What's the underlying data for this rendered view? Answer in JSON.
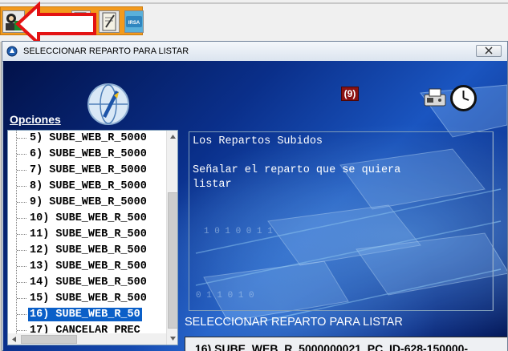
{
  "toolbar": {
    "icons": [
      "agent-icon",
      "document-icon",
      "notepad-icon",
      "irsa-icon"
    ],
    "irsa_label": "IRSA"
  },
  "window": {
    "title": "SELECCIONAR REPARTO PARA LISTAR",
    "close_glyph": "✕",
    "opciones_label": "Opciones",
    "badge": "(9)",
    "list": {
      "items": [
        "5) SUBE_WEB_R_5000",
        "6) SUBE_WEB_R_5000",
        "7) SUBE_WEB_R_5000",
        "8) SUBE_WEB_R_5000",
        "9) SUBE_WEB_R_5000",
        "10) SUBE_WEB_R_500",
        "11) SUBE_WEB_R_500",
        "12) SUBE_WEB_R_500",
        "13) SUBE_WEB_R_500",
        "14) SUBE_WEB_R_500",
        "15) SUBE_WEB_R_500",
        "16) SUBE_WEB_R_50",
        "17) CANCELAR PREC"
      ],
      "selected_index": 11
    },
    "message": {
      "line1": "Los Repartos Subidos",
      "line2": "Señalar el reparto que se quiera",
      "line3": "listar"
    },
    "bottom_label": "SELECCIONAR REPARTO PARA LISTAR",
    "selected_value": "16) SUBE_WEB_R_5000000021_PC_ID-628-150000-"
  },
  "colors": {
    "toolbar_orange": "#f39a1c",
    "arrow_red": "#e31212",
    "selection_blue": "#0a5fc8",
    "badge_red": "#8a1212"
  }
}
